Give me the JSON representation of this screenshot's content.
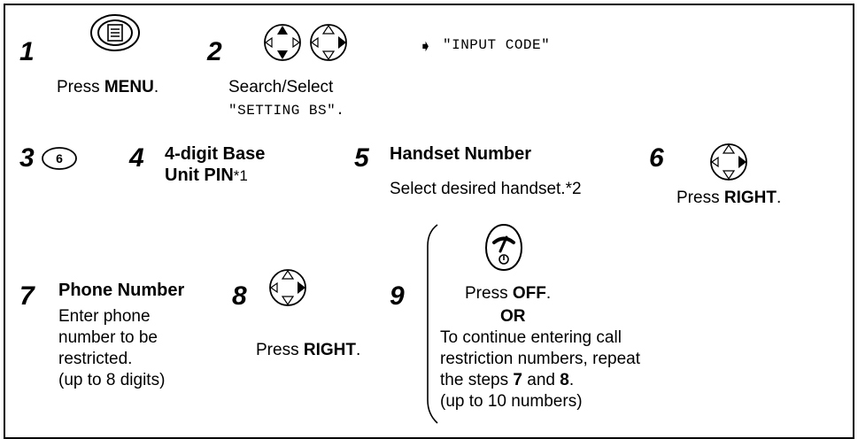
{
  "steps": [
    {
      "number": "1",
      "caption_pre": "Press ",
      "caption_bold": "MENU",
      "caption_post": ".",
      "icon": "menu-button-icon"
    },
    {
      "number": "2",
      "caption": "Search/Select",
      "caption_mono": "\"SETTING BS\".",
      "icon": "navigator-up-down-icon"
    },
    {
      "number": "3",
      "key_label": "6",
      "icon": "dial-key-6-icon"
    },
    {
      "number": "4",
      "heading_line1": "4-digit Base",
      "heading_line2": "Unit PIN",
      "footnote": "*1"
    },
    {
      "number": "5",
      "heading": "Handset Number",
      "caption": "Select desired handset.*2"
    },
    {
      "number": "6",
      "caption_pre": "Press ",
      "caption_bold": "RIGHT",
      "caption_post": ".",
      "icon": "navigator-right-icon"
    },
    {
      "number": "7",
      "heading": "Phone Number",
      "lines": [
        "Enter phone",
        "number to be",
        "restricted.",
        "(up to 8 digits)"
      ]
    },
    {
      "number": "8",
      "caption_pre": "Press ",
      "caption_bold": "RIGHT",
      "caption_post": ".",
      "icon": "navigator-right-icon"
    },
    {
      "number": "9",
      "caption_pre": "Press ",
      "caption_bold": "OFF",
      "caption_post": ".",
      "or_label": "OR",
      "line1": "To continue entering call",
      "line2": "restriction numbers, repeat",
      "line3_pre": "the steps ",
      "line3_bold1": "7",
      "line3_mid": " and ",
      "line3_bold2": "8",
      "line3_post": ".",
      "line4": "(up to 10 numbers)",
      "icon": "off-button-icon"
    }
  ],
  "display_result": {
    "arrow": "➧",
    "text": "\"INPUT CODE\""
  }
}
